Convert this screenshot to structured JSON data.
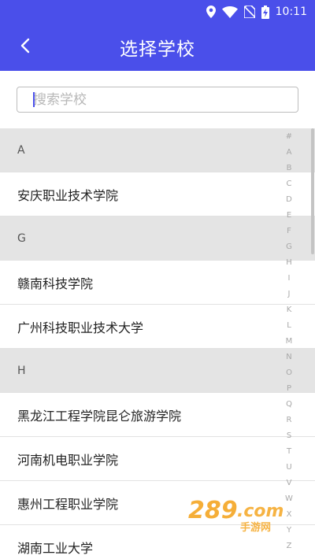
{
  "status_bar": {
    "time": "10:11",
    "icons": [
      "location-icon",
      "wifi-icon",
      "no-sim-icon",
      "battery-charging-icon"
    ]
  },
  "header": {
    "title": "选择学校",
    "back_icon": "chevron-left-icon"
  },
  "search": {
    "placeholder": "搜索学校",
    "value": ""
  },
  "list": {
    "rows": [
      {
        "type": "header",
        "text": "A"
      },
      {
        "type": "item",
        "text": "安庆职业技术学院"
      },
      {
        "type": "header",
        "text": "G"
      },
      {
        "type": "item",
        "text": "赣南科技学院"
      },
      {
        "type": "item",
        "text": "广州科技职业技术大学"
      },
      {
        "type": "header",
        "text": "H"
      },
      {
        "type": "item",
        "text": "黑龙江工程学院昆仑旅游学院"
      },
      {
        "type": "item",
        "text": "河南机电职业学院"
      },
      {
        "type": "item",
        "text": "惠州工程职业学院"
      },
      {
        "type": "item",
        "text": "湖南工业大学"
      }
    ]
  },
  "index_bar": [
    "#",
    "A",
    "B",
    "C",
    "D",
    "E",
    "F",
    "G",
    "H",
    "I",
    "J",
    "K",
    "L",
    "M",
    "N",
    "O",
    "P",
    "Q",
    "R",
    "S",
    "T",
    "U",
    "V",
    "W",
    "X",
    "Y",
    "Z"
  ],
  "colors": {
    "primary": "#4a4fea",
    "section_bg": "#e4e4e4",
    "watermark_orange": "#f5a623"
  }
}
